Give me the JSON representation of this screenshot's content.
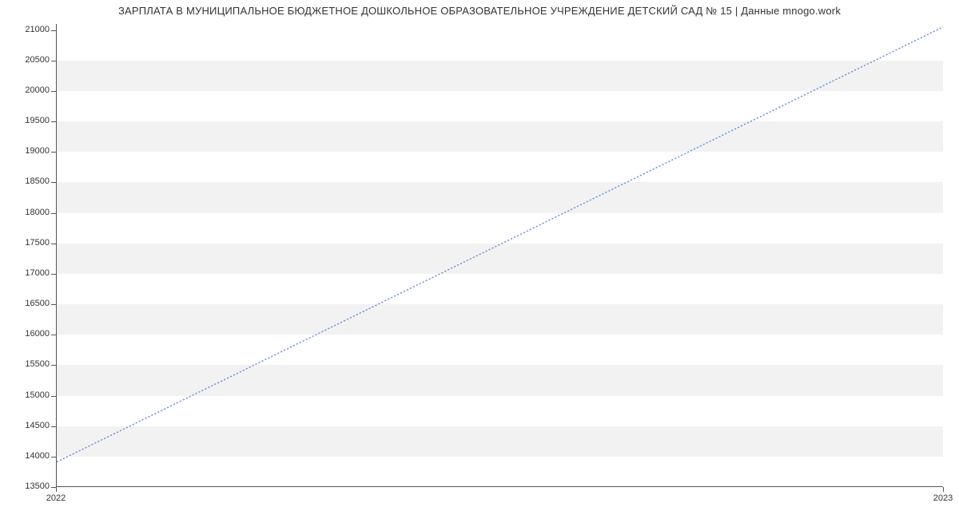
{
  "chart_data": {
    "type": "line",
    "title": "ЗАРПЛАТА В МУНИЦИПАЛЬНОЕ БЮДЖЕТНОЕ ДОШКОЛЬНОЕ ОБРАЗОВАТЕЛЬНОЕ УЧРЕЖДЕНИЕ ДЕТСКИЙ САД № 15 | Данные mnogo.work",
    "xlabel": "",
    "ylabel": "",
    "x": [
      2022,
      2023
    ],
    "values": [
      13900,
      21050
    ],
    "xlim": [
      2022,
      2023
    ],
    "ylim": [
      13500,
      21100
    ],
    "y_ticks": [
      13500,
      14000,
      14500,
      15000,
      15500,
      16000,
      16500,
      17000,
      17500,
      18000,
      18500,
      19000,
      19500,
      20000,
      20500,
      21000
    ],
    "x_ticks": [
      2022,
      2023
    ],
    "x_tick_labels": [
      "2022",
      "2023"
    ],
    "line_color": "#6a8ed8",
    "line_style": "dashed",
    "grid": "horizontal-bands"
  }
}
